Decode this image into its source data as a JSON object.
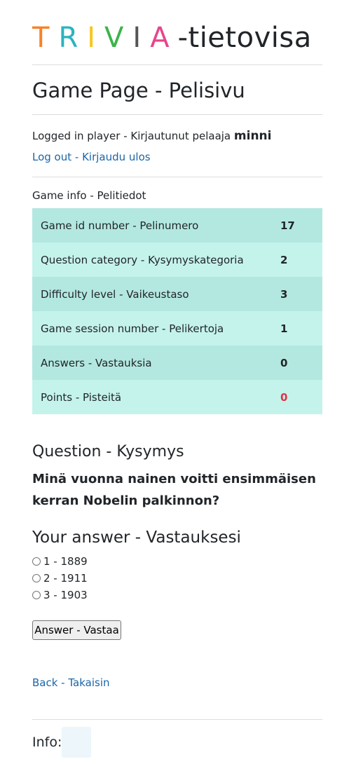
{
  "logo": {
    "letters": [
      {
        "char": "T",
        "color": "#f5822a"
      },
      {
        "char": "R",
        "color": "#2bb3c0"
      },
      {
        "char": "I",
        "color": "#f7c71c"
      },
      {
        "char": "V",
        "color": "#3cb34a"
      },
      {
        "char": "I",
        "color": "#555555"
      },
      {
        "char": "A",
        "color": "#e8458b"
      }
    ],
    "suffix": "-tietovisa"
  },
  "page_title": "Game Page - Pelisivu",
  "login": {
    "prefix": "Logged in player - Kirjautunut pelaaja ",
    "player": "minni",
    "logout_label": "Log out - Kirjaudu ulos"
  },
  "game_info": {
    "label": "Game info - Pelitiedot",
    "rows": [
      {
        "label": "Game id number - Pelinumero",
        "value": "17"
      },
      {
        "label": "Question category - Kysymyskategoria",
        "value": "2"
      },
      {
        "label": "Difficulty level - Vaikeustaso",
        "value": "3"
      },
      {
        "label": "Game session number - Pelikertoja",
        "value": "1"
      },
      {
        "label": "Answers - Vastauksia",
        "value": "0"
      },
      {
        "label": "Points - Pisteitä",
        "value": "0"
      }
    ]
  },
  "question": {
    "title": "Question - Kysymys",
    "text": "Minä vuonna nainen voitti ensimmäisen kerran Nobelin palkinnon?"
  },
  "answer": {
    "title": "Your answer - Vastauksesi",
    "options": [
      "1 - 1889",
      "2 - 1911",
      "3 - 1903"
    ],
    "button_label": "Answer - Vastaa"
  },
  "back_label": "Back - Takaisin",
  "info_label": "Info:",
  "colors": {
    "accent_link": "#1a66a8",
    "points_red": "#dc3545",
    "table_odd": "#b3e8e0",
    "table_even": "#c4f3ec"
  }
}
